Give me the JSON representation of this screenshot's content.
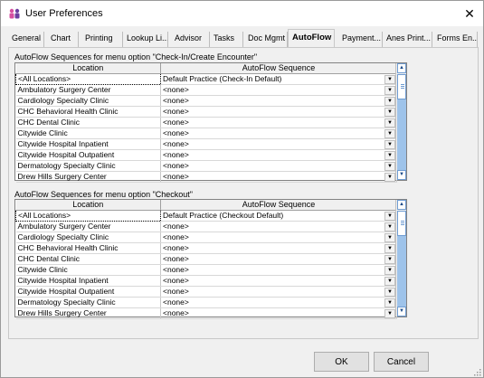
{
  "window": {
    "title": "User Preferences",
    "close_glyph": "✕"
  },
  "tabs": [
    {
      "label": "General"
    },
    {
      "label": "Chart"
    },
    {
      "label": "Printing"
    },
    {
      "label": "Lookup Li..."
    },
    {
      "label": "Advisor"
    },
    {
      "label": "Tasks"
    },
    {
      "label": "Doc Mgmt"
    },
    {
      "label": "AutoFlow"
    },
    {
      "label": "Payment..."
    },
    {
      "label": "Anes Print..."
    },
    {
      "label": "Forms En..."
    }
  ],
  "active_tab": "AutoFlow",
  "checkin": {
    "label": "AutoFlow Sequences for menu option \"Check-In/Create Encounter\"",
    "col_location": "Location",
    "col_sequence": "AutoFlow Sequence",
    "rows": [
      {
        "location": "<All Locations>",
        "sequence": "Default Practice (Check-In Default)"
      },
      {
        "location": "Ambulatory Surgery Center",
        "sequence": "<none>"
      },
      {
        "location": "Cardiology Specialty Clinic",
        "sequence": "<none>"
      },
      {
        "location": "CHC Behavioral Health Clinic",
        "sequence": "<none>"
      },
      {
        "location": "CHC Dental Clinic",
        "sequence": "<none>"
      },
      {
        "location": "Citywide Clinic",
        "sequence": "<none>"
      },
      {
        "location": "Citywide Hospital Inpatient",
        "sequence": "<none>"
      },
      {
        "location": "Citywide Hospital Outpatient",
        "sequence": "<none>"
      },
      {
        "location": "Dermatology Specialty Clinic",
        "sequence": "<none>"
      },
      {
        "location": "Drew Hills Surgery Center",
        "sequence": "<none>"
      }
    ]
  },
  "checkout": {
    "label": "AutoFlow Sequences for menu option \"Checkout\"",
    "col_location": "Location",
    "col_sequence": "AutoFlow Sequence",
    "rows": [
      {
        "location": "<All Locations>",
        "sequence": "Default Practice (Checkout Default)"
      },
      {
        "location": "Ambulatory Surgery Center",
        "sequence": "<none>"
      },
      {
        "location": "Cardiology Specialty Clinic",
        "sequence": "<none>"
      },
      {
        "location": "CHC Behavioral Health Clinic",
        "sequence": "<none>"
      },
      {
        "location": "CHC Dental Clinic",
        "sequence": "<none>"
      },
      {
        "location": "Citywide Clinic",
        "sequence": "<none>"
      },
      {
        "location": "Citywide Hospital Inpatient",
        "sequence": "<none>"
      },
      {
        "location": "Citywide Hospital Outpatient",
        "sequence": "<none>"
      },
      {
        "location": "Dermatology Specialty Clinic",
        "sequence": "<none>"
      },
      {
        "location": "Drew Hills Surgery Center",
        "sequence": "<none>"
      }
    ]
  },
  "buttons": {
    "ok": "OK",
    "cancel": "Cancel"
  },
  "icons": {
    "app": "users-icon",
    "dropdown": "dropdown-arrow-icon",
    "scroll_up": "scroll-up-icon",
    "scroll_down": "scroll-down-icon"
  },
  "colors": {
    "scroll_accent": "#9ec3ea",
    "scroll_border": "#6e9bd1",
    "app_icon_pink": "#d64fa0",
    "app_icon_purple": "#6b3fa0"
  }
}
